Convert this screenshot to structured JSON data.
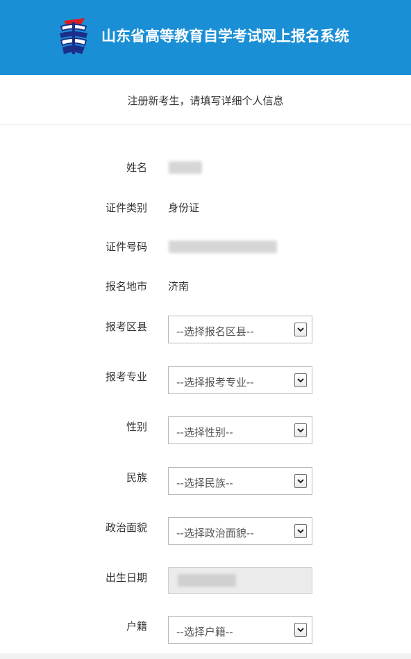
{
  "header": {
    "title": "山东省高等教育自学考试网上报名系统",
    "logo_icon": "exam-system-logo-icon",
    "bg_color": "#1a8fd6"
  },
  "subheader": {
    "text": "注册新考生，请填写详细个人信息"
  },
  "form": {
    "name": {
      "label": "姓名"
    },
    "id_type": {
      "label": "证件类别",
      "value": "身份证"
    },
    "id_number": {
      "label": "证件号码"
    },
    "city": {
      "label": "报名地市",
      "value": "济南"
    },
    "district": {
      "label": "报考区县",
      "placeholder": "--选择报名区县--"
    },
    "major": {
      "label": "报考专业",
      "placeholder": "--选择报考专业--"
    },
    "gender": {
      "label": "性别",
      "placeholder": "--选择性别--"
    },
    "ethnicity": {
      "label": "民族",
      "placeholder": "--选择民族--"
    },
    "political": {
      "label": "政治面貌",
      "placeholder": "--选择政治面貌--"
    },
    "birthdate": {
      "label": "出生日期"
    },
    "household": {
      "label": "户籍",
      "placeholder": "--选择户籍--"
    }
  }
}
